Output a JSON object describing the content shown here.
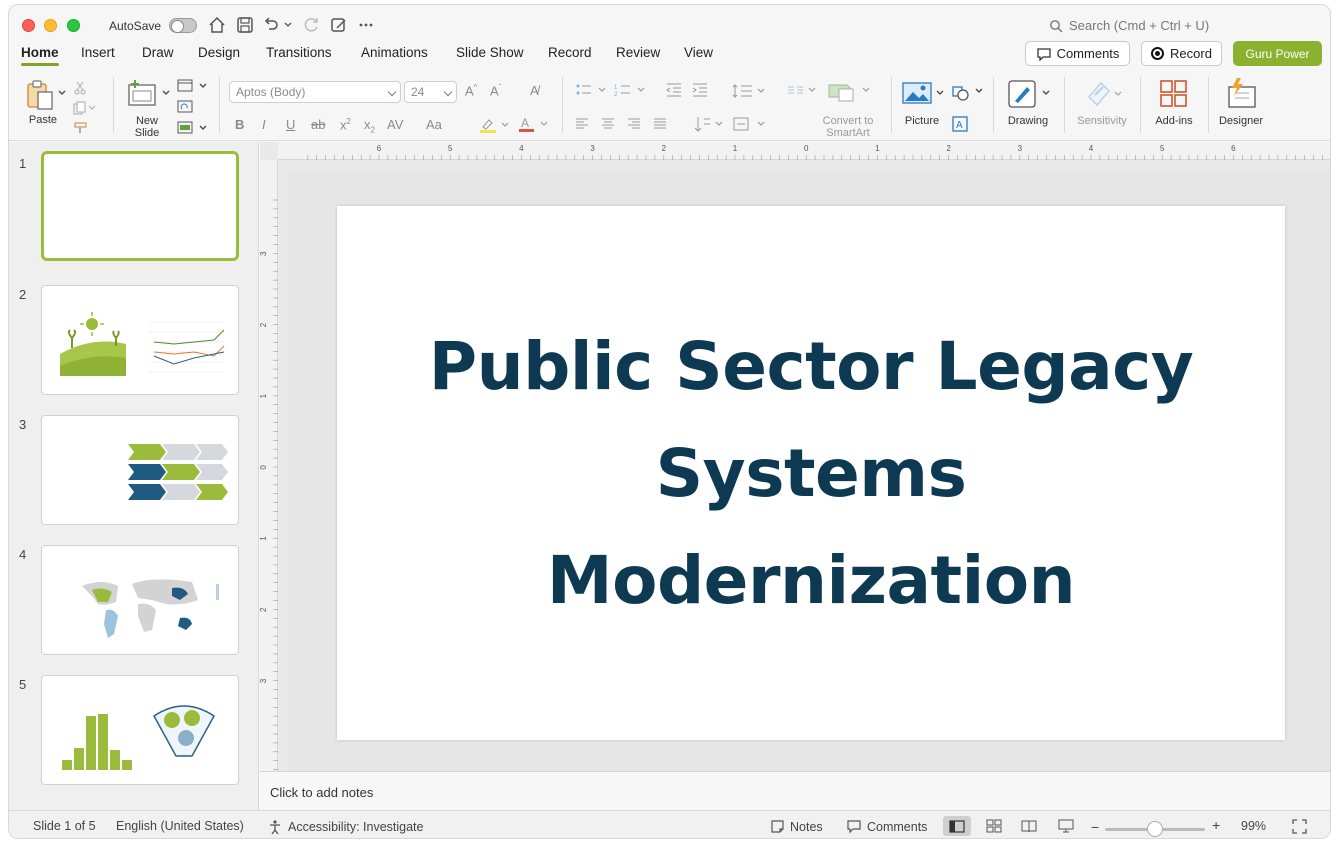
{
  "titlebar": {
    "autosave_label": "AutoSave",
    "search_placeholder": "Search (Cmd + Ctrl + U)"
  },
  "tabs": [
    {
      "label": "Home",
      "active": true
    },
    {
      "label": "Insert"
    },
    {
      "label": "Draw"
    },
    {
      "label": "Design"
    },
    {
      "label": "Transitions"
    },
    {
      "label": "Animations"
    },
    {
      "label": "Slide Show"
    },
    {
      "label": "Record"
    },
    {
      "label": "Review"
    },
    {
      "label": "View"
    }
  ],
  "header_buttons": {
    "comments": "Comments",
    "record": "Record",
    "guru": "Guru Power"
  },
  "ribbon": {
    "paste": "Paste",
    "new_slide_line1": "New",
    "new_slide_line2": "Slide",
    "font_name": "Aptos (Body)",
    "font_size": "24",
    "convert_line1": "Convert to",
    "convert_line2": "SmartArt",
    "picture": "Picture",
    "drawing": "Drawing",
    "sensitivity": "Sensitivity",
    "addins": "Add-ins",
    "designer": "Designer"
  },
  "slides": [
    {
      "number": "1"
    },
    {
      "number": "2"
    },
    {
      "number": "3"
    },
    {
      "number": "4"
    },
    {
      "number": "5"
    }
  ],
  "slide": {
    "title_line1": "Public Sector Legacy",
    "title_line2": "Systems",
    "title_line3": "Modernization"
  },
  "notes_placeholder": "Click to add notes",
  "status": {
    "slide_position": "Slide 1 of 5",
    "language": "English (United States)",
    "accessibility": "Accessibility: Investigate",
    "notes": "Notes",
    "comments": "Comments",
    "zoom": "99%"
  },
  "ruler": {
    "h_ticks": [
      "6",
      "5",
      "4",
      "3",
      "2",
      "1",
      "0",
      "1",
      "2",
      "3",
      "4",
      "5",
      "6"
    ],
    "v_ticks": [
      "3",
      "2",
      "1",
      "0",
      "1",
      "2",
      "3"
    ]
  },
  "colors": {
    "accent_green": "#8ab22e",
    "title_navy": "#0d3a52"
  }
}
